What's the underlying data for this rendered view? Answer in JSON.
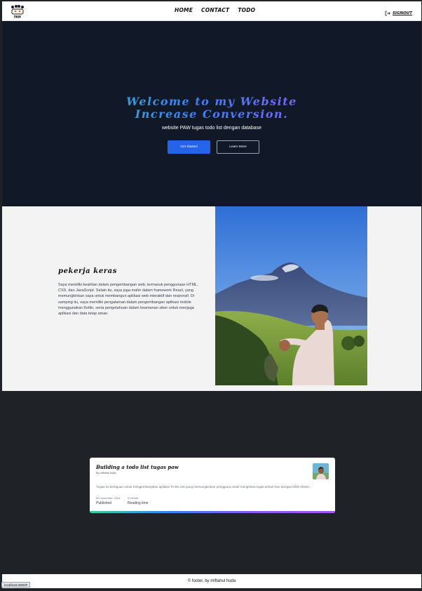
{
  "nav": {
    "logo_label": "PAW",
    "links": [
      "HOME",
      "CONTACT",
      "TODO"
    ],
    "signout": "SIGNOUT"
  },
  "hero": {
    "title_line1": "Welcome to my Website",
    "title_line2": "Increase Conversion.",
    "subtitle": "website PAW tugas todo list dengan database",
    "primary_button": "Get Started",
    "secondary_button": "Learn More"
  },
  "about": {
    "title": "pekerja keras",
    "text": "Saya memiliki keahlian dalam pengembangan web, termasuk penggunaan HTML, CSS, dan JavaScript. Selain itu, saya juga mahir dalam framework React, yang memungkinkan saya untuk membangun aplikasi web interaktif dan responsif. Di samping itu, saya memiliki pengalaman dalam pengembangan aplikasi mobile menggunakan Kotlin, serta pengetahuan dalam keamanan siber untuk menjaga aplikasi dan data tetap aman."
  },
  "blog": {
    "title": "Building a todo list tugas paw",
    "author": "By miftahul huda",
    "description": "Tugas ini bertujuan untuk mengembangkan aplikasi To-Do List yang memungkinkan pengguna untuk mengelola tugas sehari-hari dengan lebih efisien",
    "date": "30 november, 2024",
    "date_label": "Published",
    "reading": "5 minute",
    "reading_label": "Reading time"
  },
  "footer": {
    "text": "© footer, by miftahul huda"
  },
  "status_url": "localhost:3000/#",
  "colors": {
    "hero_bg": "#111827",
    "primary": "#2563eb",
    "gradient": [
      "#34d399",
      "#3b82f6",
      "#8b5cf6",
      "#a855f7"
    ]
  }
}
